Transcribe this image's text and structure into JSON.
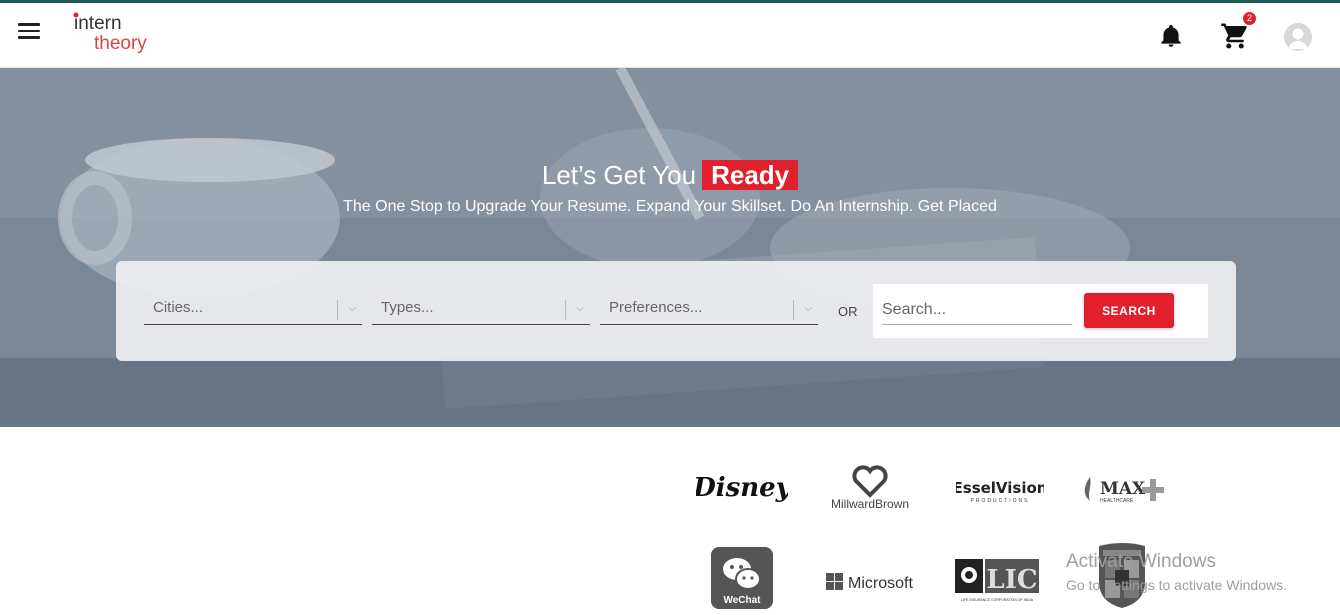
{
  "header": {
    "logo_line1": "intern",
    "logo_line2": "theory",
    "cart_count": "2"
  },
  "hero": {
    "title_prefix": "Let’s Get You",
    "title_highlight": "Ready",
    "subtitle": "The One Stop to Upgrade Your Resume. Expand Your Skillset. Do An Internship. Get Placed"
  },
  "search": {
    "cities_placeholder": "Cities...",
    "types_placeholder": "Types...",
    "preferences_placeholder": "Preferences...",
    "or_label": "OR",
    "search_placeholder": "Search...",
    "search_button": "SEARCH"
  },
  "companies": {
    "disney": "Disney",
    "millward_brown": "MillwardBrown",
    "essel_vision": "EsselVision",
    "essel_vision_sub": "PRODUCTIONS",
    "max": "MAX",
    "max_sub": "HEALTHCARE",
    "wechat": "WeChat",
    "microsoft": "Microsoft",
    "lic": "LIC",
    "lic_sub": "LIFE INSURANCE CORPORATION OF INDIA"
  },
  "watermark": {
    "line1": "Activate Windows",
    "line2": "Go to Settings to activate Windows."
  },
  "colors": {
    "accent": "#e0202c",
    "topline": "#1f5a5a"
  }
}
